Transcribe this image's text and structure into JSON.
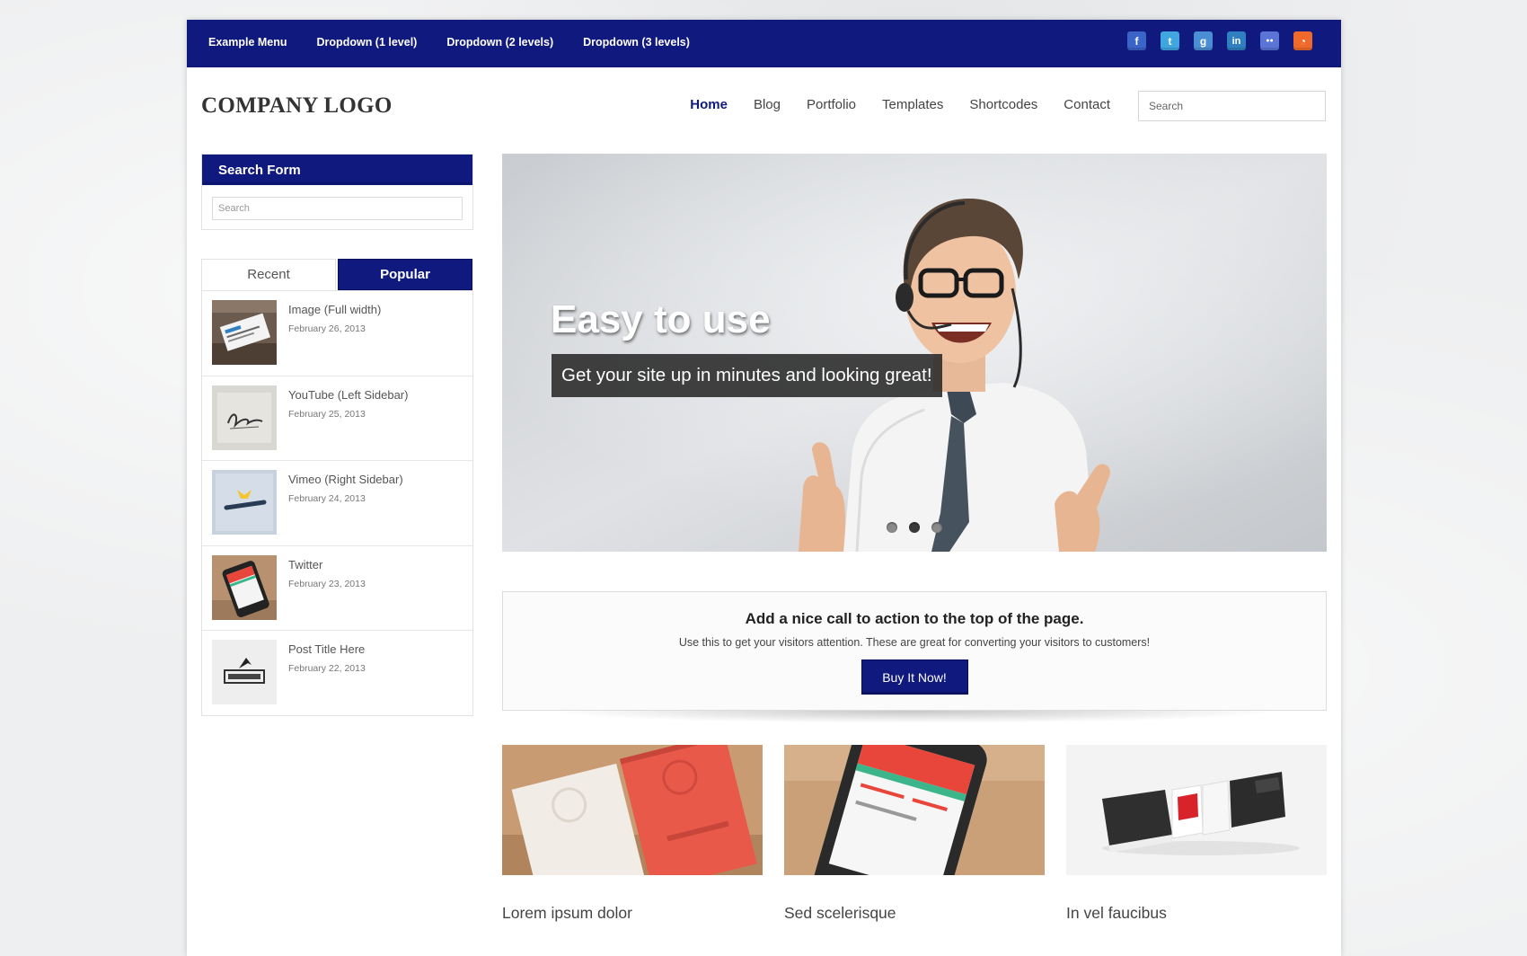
{
  "topbar": {
    "menu": [
      {
        "label": "Example Menu"
      },
      {
        "label": "Dropdown (1 level)"
      },
      {
        "label": "Dropdown (2 levels)"
      },
      {
        "label": "Dropdown (3 levels)"
      }
    ],
    "social": [
      {
        "icon": "facebook-icon",
        "glyph": "f",
        "color": "#3b64c8"
      },
      {
        "icon": "twitter-icon",
        "glyph": "t",
        "color": "#3fa6e0"
      },
      {
        "icon": "google-plus-icon",
        "glyph": "g",
        "color": "#4a8fd4"
      },
      {
        "icon": "linkedin-icon",
        "glyph": "in",
        "color": "#2f7fc1"
      },
      {
        "icon": "flickr-icon",
        "glyph": "●●",
        "color": "#5a75d6"
      },
      {
        "icon": "rss-icon",
        "glyph": "◔",
        "color": "#ef6a2a"
      }
    ]
  },
  "header": {
    "logo": "COMPANY LOGO",
    "nav": [
      {
        "label": "Home",
        "active": true
      },
      {
        "label": "Blog"
      },
      {
        "label": "Portfolio"
      },
      {
        "label": "Templates"
      },
      {
        "label": "Shortcodes"
      },
      {
        "label": "Contact"
      }
    ],
    "search_placeholder": "Search"
  },
  "sidebar": {
    "search_widget": {
      "title": "Search Form",
      "placeholder": "Search"
    },
    "tabs": {
      "recent": "Recent",
      "popular": "Popular",
      "active": "popular"
    },
    "posts": [
      {
        "title": "Image (Full width)",
        "date": "February 26, 2013"
      },
      {
        "title": "YouTube (Left Sidebar)",
        "date": "February 25, 2013"
      },
      {
        "title": "Vimeo (Right Sidebar)",
        "date": "February 24, 2013"
      },
      {
        "title": "Twitter",
        "date": "February 23, 2013"
      },
      {
        "title": "Post Title Here",
        "date": "February 22, 2013"
      }
    ]
  },
  "slider": {
    "heading": "Easy to use",
    "caption": "Get your site up in minutes and looking great!",
    "slides_count": 3,
    "active_slide": 2
  },
  "cta": {
    "title": "Add a nice call to action to the top of the page.",
    "text": "Use this to get your visitors attention. These are great for converting your visitors to customers!",
    "button": "Buy It Now!"
  },
  "portfolio": [
    {
      "caption": "Lorem ipsum dolor"
    },
    {
      "caption": "Sed scelerisque"
    },
    {
      "caption": "In vel faucibus"
    }
  ],
  "colors": {
    "brand": "#10197e"
  }
}
